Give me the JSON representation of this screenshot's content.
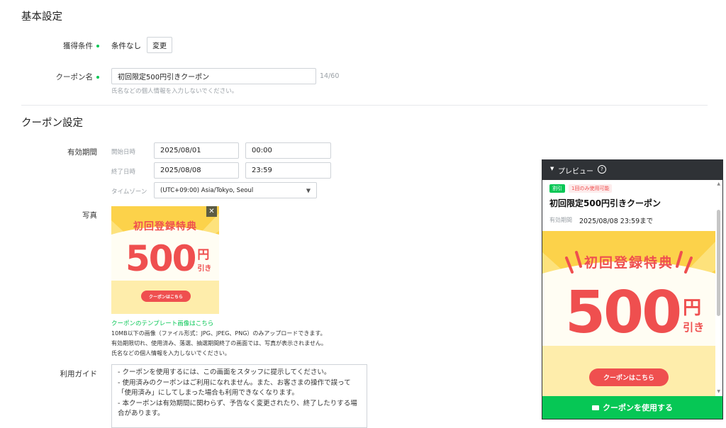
{
  "basic": {
    "title": "基本設定",
    "condition_label": "獲得条件",
    "condition_value": "条件なし",
    "change_button": "変更",
    "coupon_name_label": "クーポン名",
    "coupon_name_value": "初回限定500円引きクーポン",
    "coupon_name_count": "14/60",
    "coupon_name_hint": "氏名などの個人情報を入力しないでください。"
  },
  "coupon": {
    "title": "クーポン設定",
    "period_label": "有効期間",
    "start_label": "開始日時",
    "start_date": "2025/08/01",
    "start_time": "00:00",
    "end_label": "終了日時",
    "end_date": "2025/08/08",
    "end_time": "23:59",
    "timezone_label": "タイムゾーン",
    "timezone_value": "(UTC+09:00) Asia/Tokyo, Seoul",
    "photo_label": "写真",
    "template_link": "クーポンのテンプレート画像はこちら",
    "photo_notes": [
      "10MB以下の画像（ファイル形式：JPG、JPEG、PNG）のみアップロードできます。",
      "有効期限切れ、使用済み、落選、抽選期間終了の画面では、写真が表示されません。",
      "氏名などの個人情報を入力しないでください。"
    ],
    "guide_label": "利用ガイド",
    "guide_lines": [
      "- クーポンを使用するには、この画面をスタッフに提示してください。",
      "- 使用済みのクーポンはご利用になれません。また、お客さまの操作で誤って",
      "「使用済み」にしてしまった場合も利用できなくなります。",
      "- 本クーポンは有効期間に関わらず、予告なく変更されたり、終了したりする場",
      "合があります。"
    ]
  },
  "image": {
    "banner_text": "初回登録特典",
    "amount": "500",
    "yen": "円",
    "off": "引き",
    "pill_text": "クーポンはこちら"
  },
  "preview": {
    "header": "プレビュー",
    "badge_discount": "割引",
    "badge_once": "1回のみ使用可能",
    "title": "初回限定500円引きクーポン",
    "period_label": "有効期間",
    "period_value": "2025/08/08 23:59まで",
    "use_button": "クーポンを使用する"
  },
  "icons": {
    "dropdown": "chevron-down-icon",
    "close": "close-icon",
    "help": "help-circle-icon",
    "collapse": "caret-down-icon",
    "coupon": "ticket-icon"
  },
  "colors": {
    "accent_green": "#06c755",
    "coupon_red": "#ef4f4f",
    "coupon_yellow": "#fcd24a",
    "panel_dark": "#2f3236"
  }
}
